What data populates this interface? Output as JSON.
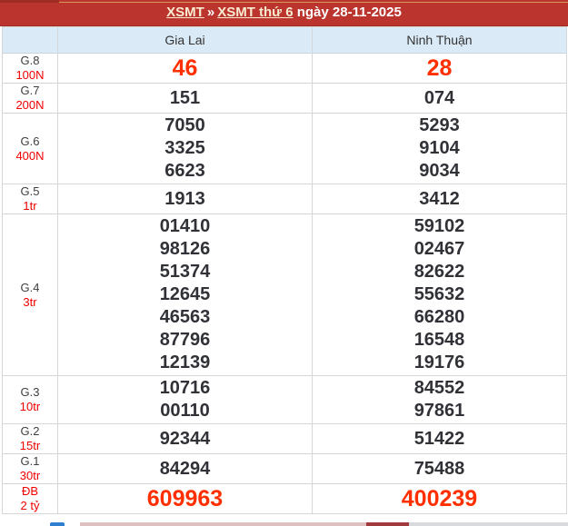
{
  "title_bar": {
    "link_root": "XSMT",
    "separator": "»",
    "link_day": "XSMT thứ 6",
    "date_text": "ngày 28-11-2025"
  },
  "table": {
    "columns": [
      {
        "label": "Gia Lai"
      },
      {
        "label": "Ninh Thuận"
      }
    ],
    "rows": [
      {
        "key": "g8",
        "prize": "G.8",
        "amount": "100N",
        "highlight": true,
        "label_red": false,
        "gia_lai": [
          "46"
        ],
        "ninh_thuan": [
          "28"
        ]
      },
      {
        "key": "g7",
        "prize": "G.7",
        "amount": "200N",
        "highlight": false,
        "label_red": false,
        "gia_lai": [
          "151"
        ],
        "ninh_thuan": [
          "074"
        ]
      },
      {
        "key": "g6",
        "prize": "G.6",
        "amount": "400N",
        "highlight": false,
        "label_red": false,
        "gia_lai": [
          "7050",
          "3325",
          "6623"
        ],
        "ninh_thuan": [
          "5293",
          "9104",
          "9034"
        ]
      },
      {
        "key": "g5",
        "prize": "G.5",
        "amount": "1tr",
        "highlight": false,
        "label_red": false,
        "gia_lai": [
          "1913"
        ],
        "ninh_thuan": [
          "3412"
        ]
      },
      {
        "key": "g4",
        "prize": "G.4",
        "amount": "3tr",
        "highlight": false,
        "label_red": false,
        "gia_lai": [
          "01410",
          "98126",
          "51374",
          "12645",
          "46563",
          "87796",
          "12139"
        ],
        "ninh_thuan": [
          "59102",
          "02467",
          "82622",
          "55632",
          "66280",
          "16548",
          "19176"
        ]
      },
      {
        "key": "g3",
        "prize": "G.3",
        "amount": "10tr",
        "highlight": false,
        "label_red": false,
        "gia_lai": [
          "10716",
          "00110"
        ],
        "ninh_thuan": [
          "84552",
          "97861"
        ]
      },
      {
        "key": "g2",
        "prize": "G.2",
        "amount": "15tr",
        "highlight": false,
        "label_red": false,
        "gia_lai": [
          "92344"
        ],
        "ninh_thuan": [
          "51422"
        ]
      },
      {
        "key": "g1",
        "prize": "G.1",
        "amount": "30tr",
        "highlight": false,
        "label_red": false,
        "gia_lai": [
          "84294"
        ],
        "ninh_thuan": [
          "75488"
        ]
      },
      {
        "key": "db",
        "prize": "ĐB",
        "amount": "2 tỷ",
        "highlight": true,
        "label_red": true,
        "gia_lai": [
          "609963"
        ],
        "ninh_thuan": [
          "400239"
        ]
      }
    ]
  },
  "colors": {
    "title_bar_red": "#bb342e",
    "title_bar_dark_red": "#9e2b24",
    "title_link_cream": "#f7ecd0",
    "header_blue": "#daeaf6",
    "highlight_number_red": "#ff2f00",
    "label_red": "#f00000",
    "number_dark": "#313237"
  }
}
